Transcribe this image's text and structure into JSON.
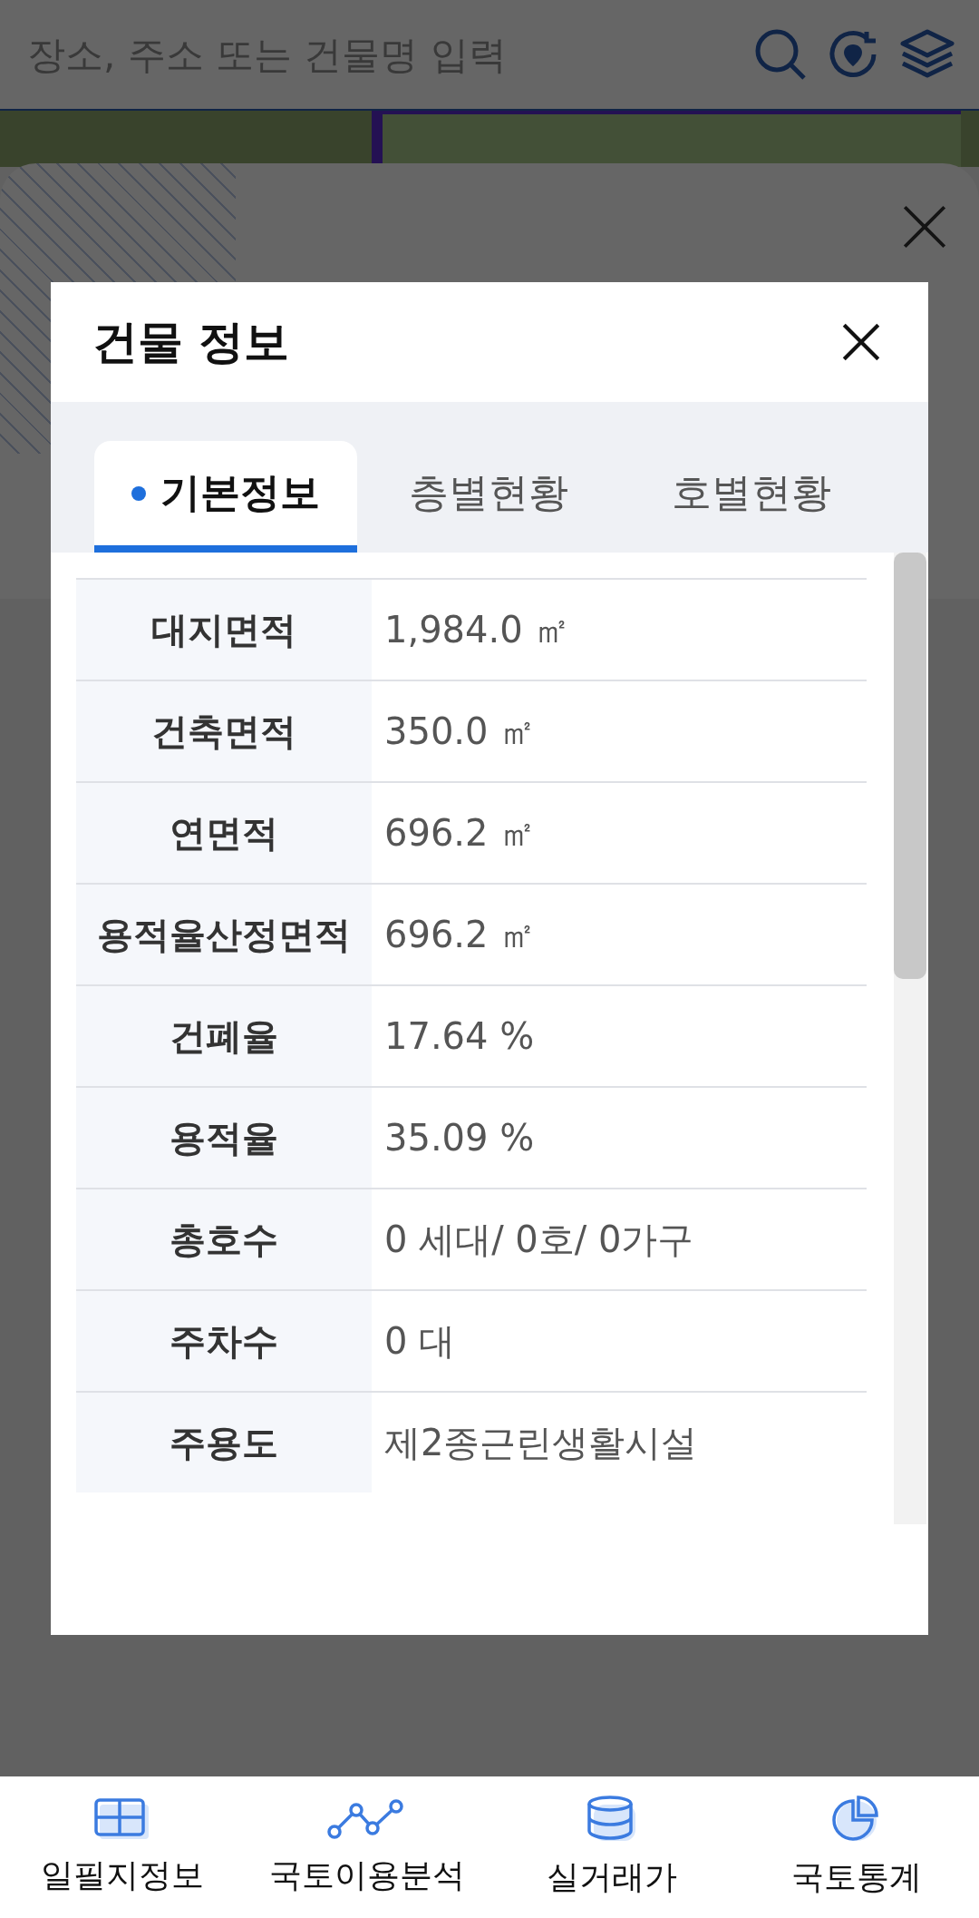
{
  "search": {
    "placeholder": "장소, 주소 또는 건물명 입력"
  },
  "dialog": {
    "title": "건물 정보",
    "tabs": [
      {
        "label": "기본정보",
        "selected": true
      },
      {
        "label": "층별현황",
        "selected": false
      },
      {
        "label": "호별현황",
        "selected": false
      }
    ],
    "rows": [
      {
        "label": "대지면적",
        "value": "1,984.0 ㎡"
      },
      {
        "label": "건축면적",
        "value": "350.0 ㎡"
      },
      {
        "label": "연면적",
        "value": "696.2 ㎡"
      },
      {
        "label": "용적율산정면적",
        "value": "696.2 ㎡"
      },
      {
        "label": "건폐율",
        "value": "17.64 %"
      },
      {
        "label": "용적율",
        "value": "35.09 %"
      },
      {
        "label": "총호수",
        "value": "0 세대/ 0호/ 0가구"
      },
      {
        "label": "주차수",
        "value": "0 대"
      },
      {
        "label": "주용도",
        "value": "제2종근린생활시설"
      }
    ]
  },
  "bottom_nav": [
    {
      "kind": "grid",
      "label": "일필지정보"
    },
    {
      "kind": "chart",
      "label": "국토이용분석"
    },
    {
      "kind": "database",
      "label": "실거래가"
    },
    {
      "kind": "pie",
      "label": "국토통계"
    }
  ]
}
